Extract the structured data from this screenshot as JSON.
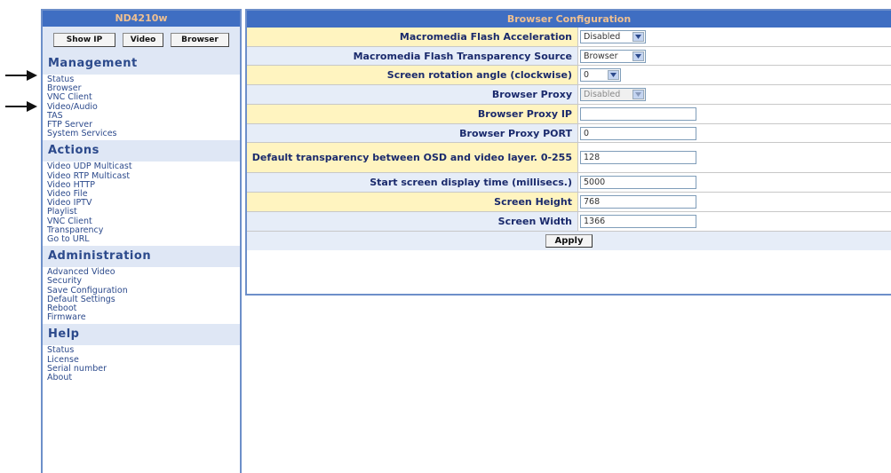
{
  "sidebar": {
    "title": "ND4210w",
    "buttons": [
      "Show IP",
      "Video",
      "Browser"
    ],
    "sections": [
      {
        "title": "Management",
        "items": [
          "Status",
          "Browser",
          "VNC Client",
          "Video/Audio",
          "TAS",
          "FTP Server",
          "System Services"
        ]
      },
      {
        "title": "Actions",
        "items": [
          "Video UDP Multicast",
          "Video RTP Multicast",
          "Video HTTP",
          "Video File",
          "Video IPTV",
          "Playlist",
          "VNC Client",
          "Transparency",
          "Go to URL"
        ]
      },
      {
        "title": "Administration",
        "items": [
          "Advanced Video",
          "Security",
          "Save Configuration",
          "Default Settings",
          "Reboot",
          "Firmware"
        ]
      },
      {
        "title": "Help",
        "items": [
          "Status",
          "License",
          "Serial number",
          "About"
        ]
      }
    ]
  },
  "main": {
    "title": "Browser Configuration",
    "fields": [
      {
        "label": "Macromedia Flash Acceleration",
        "type": "select",
        "value": "Disabled"
      },
      {
        "label": "Macromedia Flash Transparency Source",
        "type": "select",
        "value": "Browser"
      },
      {
        "label": "Screen rotation angle (clockwise)",
        "type": "select",
        "value": "0"
      },
      {
        "label": "Browser Proxy",
        "type": "select",
        "value": "Disabled"
      },
      {
        "label": "Browser Proxy IP",
        "type": "text",
        "value": ""
      },
      {
        "label": "Browser Proxy PORT",
        "type": "text",
        "value": "0"
      },
      {
        "label": "Default transparency between OSD and video layer. 0-255",
        "type": "text",
        "value": "128"
      },
      {
        "label": "Start screen display time (millisecs.)",
        "type": "text",
        "value": "5000"
      },
      {
        "label": "Screen Height",
        "type": "text",
        "value": "768"
      },
      {
        "label": "Screen Width",
        "type": "text",
        "value": "1366"
      }
    ],
    "apply_label": "Apply"
  }
}
